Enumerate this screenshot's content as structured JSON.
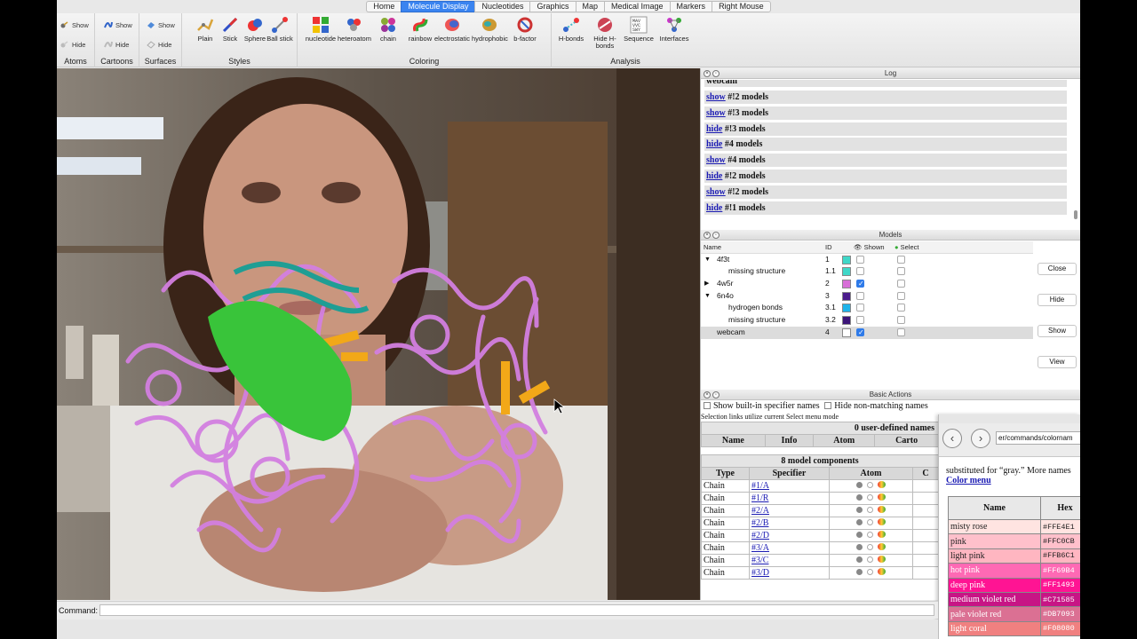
{
  "tabs": [
    "Home",
    "Molecule Display",
    "Nucleotides",
    "Graphics",
    "Map",
    "Medical Image",
    "Markers",
    "Right Mouse"
  ],
  "active_tab": "Molecule Display",
  "ribbon": {
    "atoms": {
      "show": "Show",
      "hide": "Hide",
      "label": "Atoms"
    },
    "cartoons": {
      "show": "Show",
      "hide": "Hide",
      "label": "Cartoons"
    },
    "surfaces": {
      "show": "Show",
      "hide": "Hide",
      "label": "Surfaces"
    },
    "styles": {
      "label": "Styles",
      "buttons": [
        "Plain",
        "Stick",
        "Sphere",
        "Ball stick"
      ]
    },
    "coloring": {
      "label": "Coloring",
      "buttons": [
        "nucleotide",
        "heteroatom",
        "chain",
        "rainbow",
        "electrostatic",
        "hydrophobic",
        "b-factor"
      ]
    },
    "analysis": {
      "label": "Analysis",
      "buttons": [
        "H-bonds",
        "Hide H-bonds",
        "Sequence",
        "Interfaces"
      ]
    }
  },
  "log": {
    "title": "Log",
    "first_partial": "webcam",
    "lines": [
      {
        "cmd": "show",
        "rest": "#!2 models"
      },
      {
        "cmd": "show",
        "rest": "#!3 models"
      },
      {
        "cmd": "hide",
        "rest": "#!3 models"
      },
      {
        "cmd": "hide",
        "rest": "#4 models"
      },
      {
        "cmd": "show",
        "rest": "#4 models"
      },
      {
        "cmd": "hide",
        "rest": "#!2 models"
      },
      {
        "cmd": "show",
        "rest": "#!2 models"
      },
      {
        "cmd": "hide",
        "rest": "#!1 models"
      }
    ]
  },
  "models": {
    "title": "Models",
    "headers": {
      "name": "Name",
      "id": "ID",
      "shown": "Shown",
      "select": "Select"
    },
    "rows": [
      {
        "arrow": "▼",
        "name": "4f3t",
        "id": "1",
        "color": "#3fd8c8",
        "shown": false,
        "indent": 0
      },
      {
        "arrow": "",
        "name": "missing structure",
        "id": "1.1",
        "color": "#3fd8c8",
        "shown": false,
        "indent": 1
      },
      {
        "arrow": "▶",
        "name": "4w5r",
        "id": "2",
        "color": "#d86fd8",
        "shown": true,
        "indent": 0
      },
      {
        "arrow": "▼",
        "name": "6n4o",
        "id": "3",
        "color": "#4b1c8c",
        "shown": false,
        "indent": 0
      },
      {
        "arrow": "",
        "name": "hydrogen bonds",
        "id": "3.1",
        "color": "#1fb4ea",
        "shown": false,
        "indent": 1
      },
      {
        "arrow": "",
        "name": "missing structure",
        "id": "3.2",
        "color": "#3b1478",
        "shown": false,
        "indent": 1
      },
      {
        "arrow": "",
        "name": "webcam",
        "id": "4",
        "color": "#ffffff",
        "shown": true,
        "indent": 0
      }
    ],
    "buttons": [
      "Close",
      "Hide",
      "Show",
      "View"
    ]
  },
  "basic_actions": {
    "title": "Basic Actions",
    "opt_builtin": "Show built-in specifier names",
    "opt_hide": "Hide non-matching names",
    "note": "Selection links utilize current Select menu mode",
    "user_defined": "0 user-defined names",
    "user_headers": [
      "Name",
      "Info",
      "Atom",
      "Carto"
    ],
    "model_components": "8 model components",
    "comp_headers": [
      "Type",
      "Specifier",
      "Atom",
      "C"
    ],
    "components": [
      {
        "type": "Chain",
        "spec": "#1/A"
      },
      {
        "type": "Chain",
        "spec": "#1/R"
      },
      {
        "type": "Chain",
        "spec": "#2/A"
      },
      {
        "type": "Chain",
        "spec": "#2/B"
      },
      {
        "type": "Chain",
        "spec": "#2/D"
      },
      {
        "type": "Chain",
        "spec": "#3/A"
      },
      {
        "type": "Chain",
        "spec": "#3/C"
      },
      {
        "type": "Chain",
        "spec": "#3/D"
      }
    ]
  },
  "help": {
    "url": "er/commands/colornam",
    "text": "substituted for “gray.” More names",
    "link": "Color menu",
    "headers": [
      "Name",
      "Hex"
    ],
    "colors": [
      {
        "name": "misty rose",
        "hex": "#FFE4E1",
        "bg": "#ffe4e1",
        "fg": "#222"
      },
      {
        "name": "pink",
        "hex": "#FFC0CB",
        "bg": "#ffc0cb",
        "fg": "#222"
      },
      {
        "name": "light pink",
        "hex": "#FFB6C1",
        "bg": "#ffb6c1",
        "fg": "#222"
      },
      {
        "name": "hot pink",
        "hex": "#FF69B4",
        "bg": "#ff69b4",
        "fg": "#fff"
      },
      {
        "name": "deep pink",
        "hex": "#FF1493",
        "bg": "#ff1493",
        "fg": "#fff"
      },
      {
        "name": "medium violet red",
        "hex": "#C71585",
        "bg": "#c71585",
        "fg": "#fff"
      },
      {
        "name": "pale violet red",
        "hex": "#DB7093",
        "bg": "#db7093",
        "fg": "#fff"
      },
      {
        "name": "light coral",
        "hex": "#F08080",
        "bg": "#f08080",
        "fg": "#fff"
      }
    ]
  },
  "command": {
    "label": "Command:",
    "value": ""
  }
}
